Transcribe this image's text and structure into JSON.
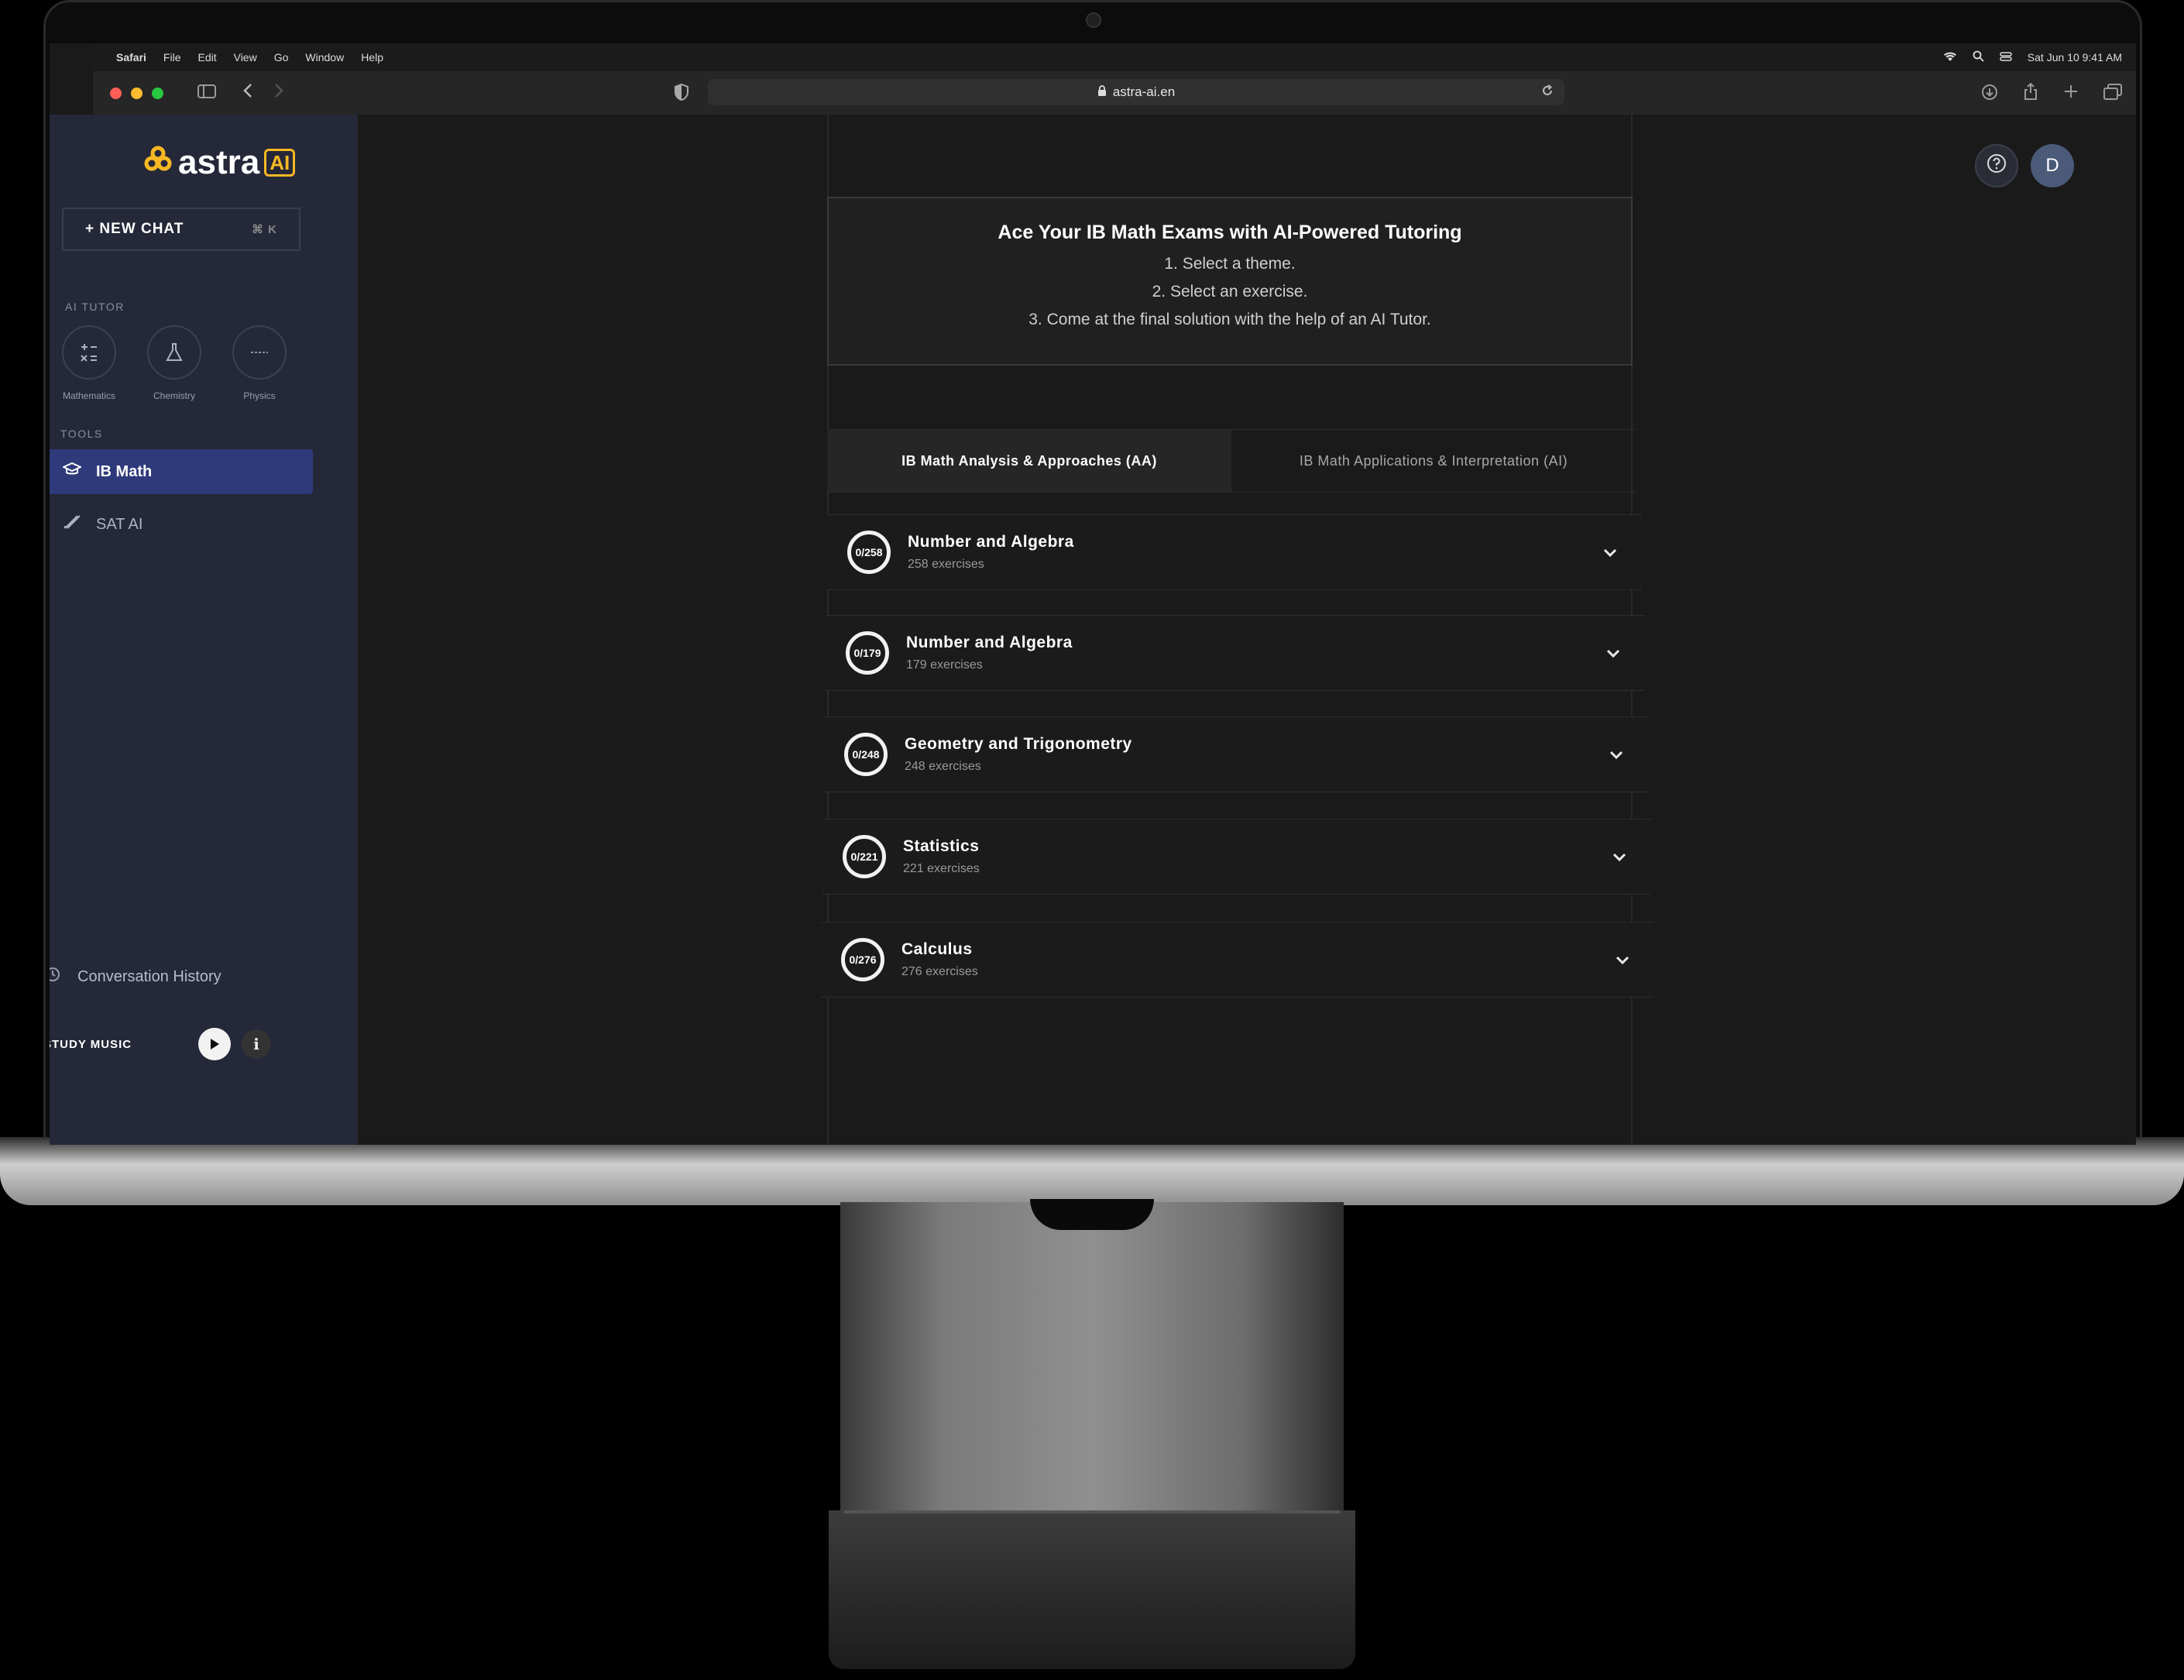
{
  "menubar": {
    "items": [
      "Safari",
      "File",
      "Edit",
      "View",
      "Go",
      "Window",
      "Help"
    ],
    "datetime": "Sat Jun 10  9:41 AM"
  },
  "browser": {
    "url": "astra-ai.en"
  },
  "sidebar": {
    "logo_text": "astra",
    "logo_badge": "AI",
    "new_chat_label": "+ NEW CHAT",
    "new_chat_shortcut": "⌘ K",
    "ai_tutor_label": "AI TUTOR",
    "tutors": [
      {
        "label": "Mathematics",
        "icon": "math-symbols-icon"
      },
      {
        "label": "Chemistry",
        "icon": "flask-icon"
      },
      {
        "label": "Physics",
        "icon": "atom-icon"
      }
    ],
    "tools_label": "TOOLS",
    "tools": [
      {
        "label": "IB Math",
        "icon": "graduation-cap-icon",
        "active": true
      },
      {
        "label": "SAT AI",
        "icon": "pencil-ruler-icon",
        "active": false
      }
    ],
    "history_label": "Conversation History",
    "study_music_label": "STUDY MUSIC"
  },
  "main": {
    "hero": {
      "title": "Ace Your IB Math Exams with AI-Powered Tutoring",
      "steps": [
        "1. Select a theme.",
        "2. Select an exercise.",
        "3. Come at the final solution with the help of an AI Tutor."
      ]
    },
    "tabs": [
      {
        "label": "IB Math Analysis & Approaches (AA)",
        "active": true
      },
      {
        "label": "IB Math Applications & Interpretation (AI)",
        "active": false
      }
    ],
    "topics": [
      {
        "name": "Number and Algebra",
        "progress": "0/258",
        "count": "258 exercises"
      },
      {
        "name": "Number and Algebra",
        "progress": "0/179",
        "count": "179 exercises"
      },
      {
        "name": "Geometry and Trigonometry",
        "progress": "0/248",
        "count": "248 exercises"
      },
      {
        "name": "Statistics",
        "progress": "0/221",
        "count": "221 exercises"
      },
      {
        "name": "Calculus",
        "progress": "0/276",
        "count": "276 exercises"
      }
    ]
  },
  "header": {
    "help_icon": "question-mark-icon",
    "avatar_initial": "D"
  },
  "colors": {
    "accent": "#f7b824",
    "active_tool": "#2e3a7a",
    "sidebar_bg": "#252838"
  }
}
